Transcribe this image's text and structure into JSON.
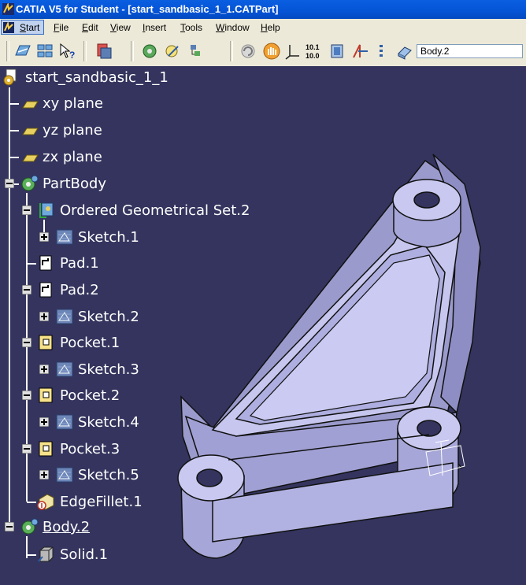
{
  "window": {
    "title": "CATIA V5 for Student - [start_sandbasic_1_1.CATPart]"
  },
  "menu": {
    "start": "Start",
    "items": [
      "File",
      "Edit",
      "View",
      "Insert",
      "Tools",
      "Window",
      "Help"
    ]
  },
  "toolbar": {
    "body_selector": "Body.2",
    "icons": [
      "spec-tree-icon",
      "compass-icon",
      "whats-this-icon",
      "catalog-icon",
      "part-design-icon",
      "sketch-icon",
      "material-icon",
      "rotate-icon",
      "pan-icon",
      "axis-icon",
      "measure-icon",
      "view-icon",
      "split-icon",
      "list-icon",
      "body-icon"
    ]
  },
  "tree": {
    "root": "start_sandbasic_1_1",
    "xy": "xy plane",
    "yz": "yz plane",
    "zx": "zx plane",
    "partbody": "PartBody",
    "ogs": "Ordered Geometrical Set.2",
    "sketch1": "Sketch.1",
    "pad1": "Pad.1",
    "pad2": "Pad.2",
    "sketch2": "Sketch.2",
    "pocket1": "Pocket.1",
    "sketch3": "Sketch.3",
    "pocket2": "Pocket.2",
    "sketch4": "Sketch.4",
    "pocket3": "Pocket.3",
    "sketch5": "Sketch.5",
    "fillet": "EdgeFillet.1",
    "body2": "Body.2",
    "solid": "Solid.1"
  },
  "colors": {
    "background": "#34345e",
    "part_face": "#c8c8f0",
    "part_side": "#9c9cce",
    "titlebar": "#0554d6",
    "menubar": "#ece9d8"
  }
}
